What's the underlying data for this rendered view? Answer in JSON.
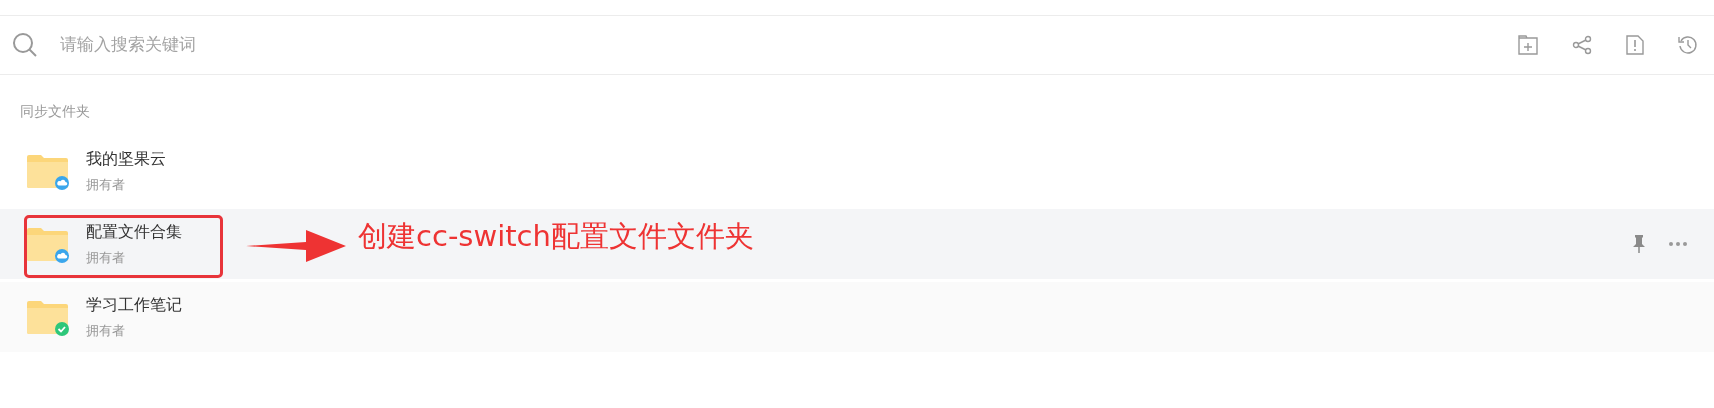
{
  "search": {
    "placeholder": "请输入搜索关键词"
  },
  "section_title": "同步文件夹",
  "folders": [
    {
      "name": "我的坚果云",
      "role": "拥有者",
      "kind": "cloud",
      "selected": false
    },
    {
      "name": "配置文件合集",
      "role": "拥有者",
      "kind": "cloud",
      "selected": true
    },
    {
      "name": "学习工作笔记",
      "role": "拥有者",
      "kind": "synced",
      "selected": false
    }
  ],
  "annotation": {
    "text": "创建cc-switch配置文件文件夹"
  }
}
